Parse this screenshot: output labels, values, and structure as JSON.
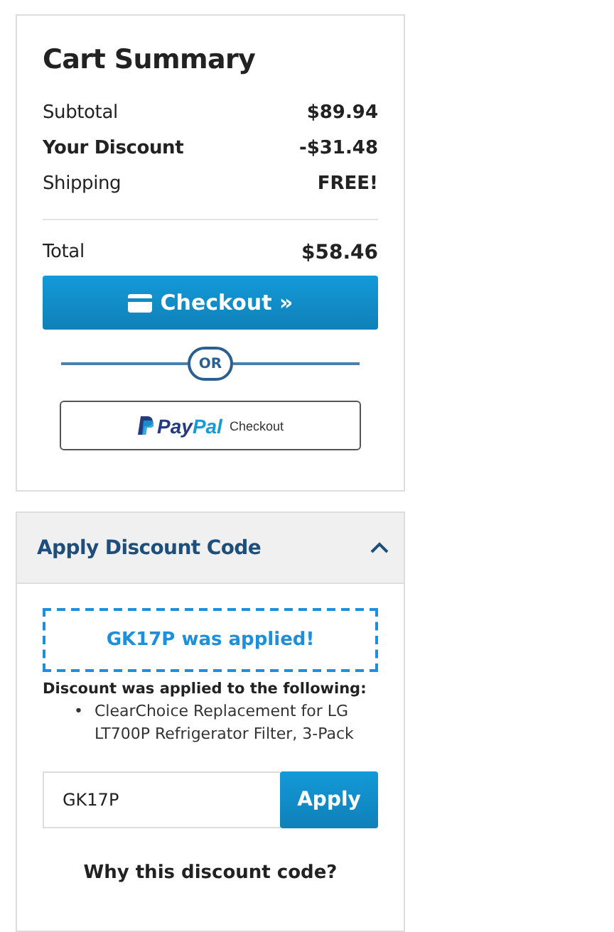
{
  "cart_summary": {
    "title": "Cart Summary",
    "lines": [
      {
        "label": "Subtotal",
        "value": "$89.94",
        "emphasis": false
      },
      {
        "label": "Your Discount",
        "value": "-$31.48",
        "emphasis": true
      },
      {
        "label": "Shipping",
        "value": "FREE!",
        "emphasis": false
      }
    ],
    "total": {
      "label": "Total",
      "value": "$58.46"
    },
    "checkout_button": "Checkout »",
    "divider_text": "OR",
    "paypal_button": {
      "brand_first": "Pay",
      "brand_second": "Pal",
      "label": "Checkout"
    }
  },
  "discount_panel": {
    "title": "Apply Discount Code",
    "expanded": true,
    "applied_message": "GK17P was applied!",
    "applied_to_heading": "Discount was applied to the following:",
    "applied_items": [
      {
        "marker": "•",
        "text": "ClearChoice Replacement for LG LT700P Refrigerator Filter, 3-Pack"
      }
    ],
    "code_field": {
      "value": "GK17P"
    },
    "apply_button": "Apply",
    "why_link": "Why this discount code?"
  }
}
